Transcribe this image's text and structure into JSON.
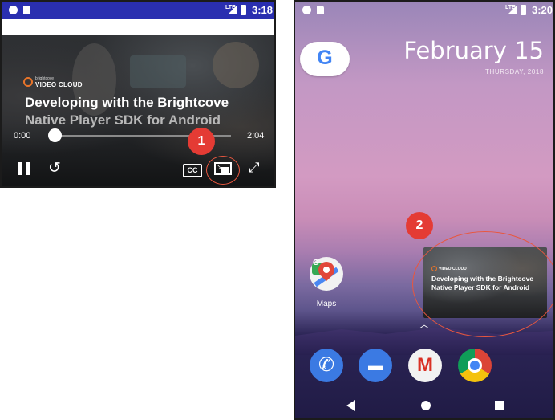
{
  "left_phone": {
    "status_time": "3:18",
    "status_network": "LTE",
    "video": {
      "brand_small": "brightcove",
      "brand_big": "VIDEO CLOUD",
      "title_line1": "Developing with the Brightcove",
      "title_line2": "Native Player SDK for Android",
      "current_time": "0:00",
      "duration": "2:04",
      "progress": 0.0
    },
    "controls": {
      "replay_glyph": "↺",
      "cc_label": "CC",
      "fullscreen_glyph": "⤢"
    },
    "callout": "1"
  },
  "right_phone": {
    "status_time": "3:20",
    "status_network": "LTE",
    "google_glyph": "G",
    "date": "February 15",
    "weekday": "THURSDAY, 2018",
    "apps": [
      {
        "label": "Maps",
        "icon": "maps-icon"
      }
    ],
    "pip": {
      "brand_big": "VIDEO CLOUD",
      "title_line1": "Developing with the Brightcove",
      "title_line2": "Native Player SDK for Android"
    },
    "dock": [
      {
        "icon": "phone-icon",
        "glyph": "✆"
      },
      {
        "icon": "messages-icon",
        "glyph": "▬"
      },
      {
        "icon": "gmail-icon",
        "glyph": "M"
      },
      {
        "icon": "chrome-icon",
        "glyph": ""
      }
    ],
    "chevron_glyph": "︿",
    "callout": "2"
  },
  "colors": {
    "callout_red": "#e43b34",
    "status_bar_blue": "#2a2fb0",
    "accent_orange": "#e8742a"
  }
}
